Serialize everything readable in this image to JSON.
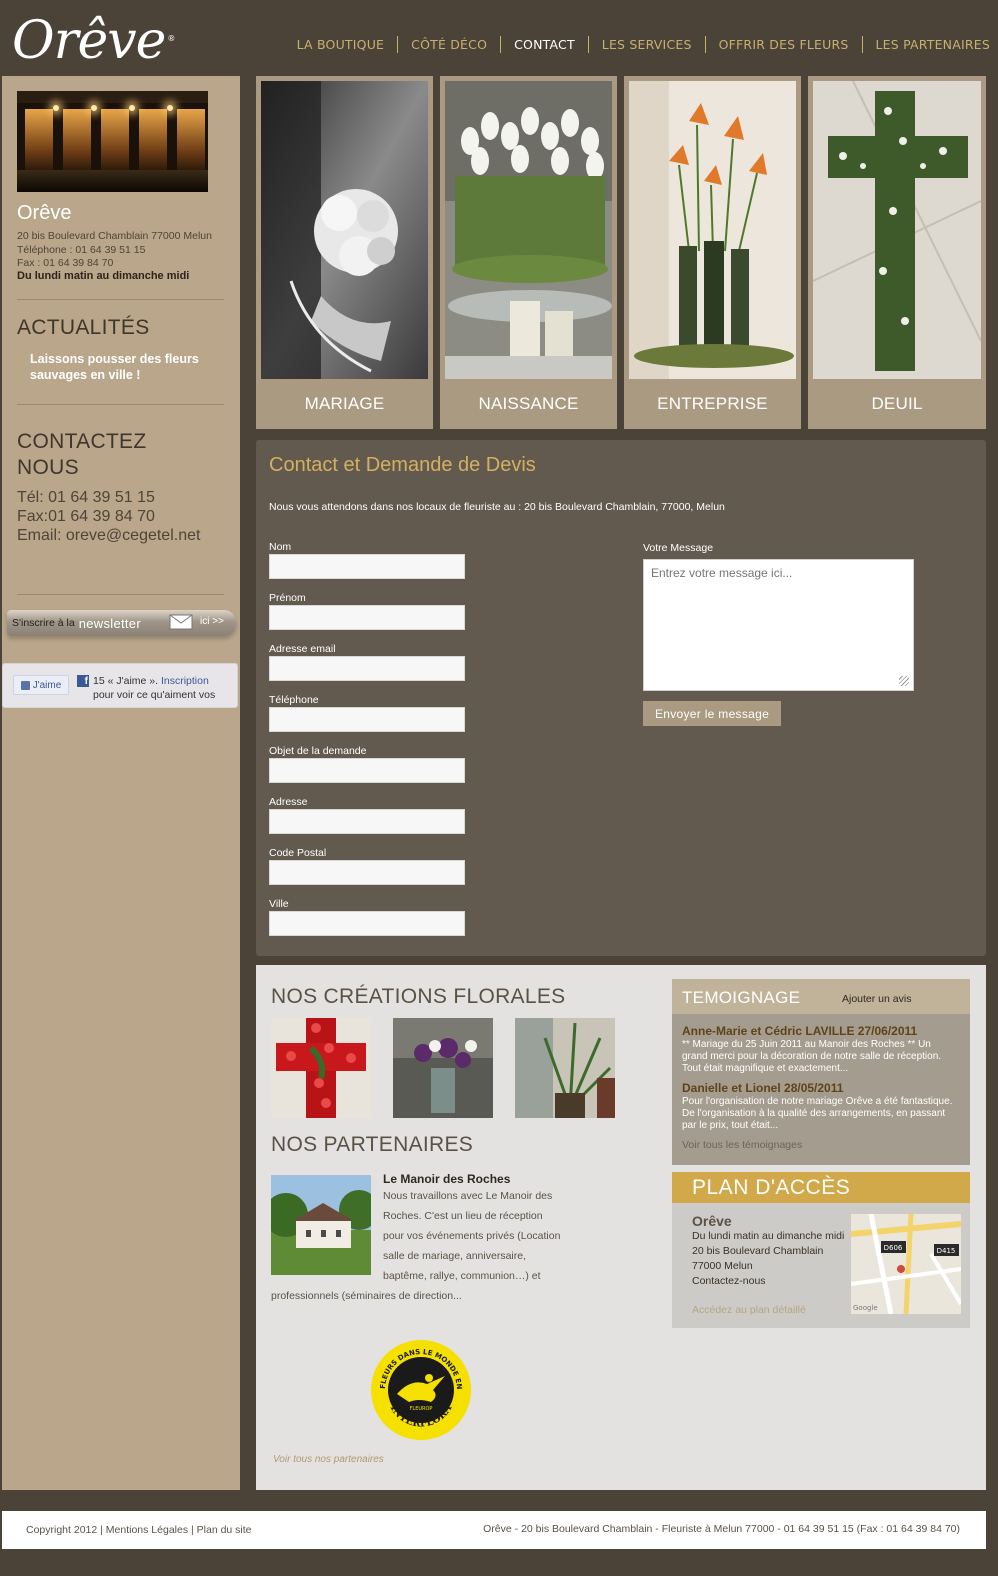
{
  "header": {
    "logo_text": "Orêve",
    "logo_mark": "®",
    "nav": [
      {
        "label": "LA BOUTIQUE"
      },
      {
        "label": "CÔTÉ DÉCO"
      },
      {
        "label": "CONTACT"
      },
      {
        "label": "LES SERVICES"
      },
      {
        "label": "OFFRIR DES FLEURS"
      },
      {
        "label": "LES PARTENAIRES"
      }
    ],
    "active_nav": "CONTACT"
  },
  "sidebar": {
    "shop_name": "Orêve",
    "address": "20 bis Boulevard Chamblain 77000 Melun",
    "phone": "Téléphone : 01 64 39 51 15",
    "fax": "Fax : 01 64 39 84 70",
    "hours": "Du lundi matin au dimanche midi",
    "news_heading": "ACTUALITÉS",
    "news_item": "Laissons pousser des fleurs sauvages en ville !",
    "contact_heading_1": "CONTACTEZ",
    "contact_heading_2": "NOUS",
    "contact_tel": "Tél: 01 64 39 51 15",
    "contact_fax": "Fax:01 64 39 84 70",
    "contact_email": "Email: oreve@cegetel.net",
    "newsletter_pre": "S'inscrire à la",
    "newsletter_big": "newsletter",
    "newsletter_ici": "ici >>",
    "fb_like": "J'aime",
    "fb_count": "15 « J'aime ».",
    "fb_signup": "Inscription",
    "fb_rest": "pour voir ce qu'aiment vos"
  },
  "tiles": [
    {
      "label": "MARIAGE"
    },
    {
      "label": "NAISSANCE"
    },
    {
      "label": "ENTREPRISE"
    },
    {
      "label": "DEUIL"
    }
  ],
  "contact_form": {
    "title": "Contact et Demande de Devis",
    "intro": "Nous vous attendons dans nos locaux de fleuriste au : 20 bis Boulevard Chamblain, 77000, Melun",
    "fields": {
      "nom": "Nom",
      "prenom": "Prénom",
      "email": "Adresse email",
      "telephone": "Téléphone",
      "objet": "Objet de la demande",
      "adresse": "Adresse",
      "cp": "Code Postal",
      "ville": "Ville"
    },
    "message_label": "Votre Message",
    "message_placeholder": "Entrez votre message ici...",
    "submit": "Envoyer le message"
  },
  "creations": {
    "title": "NOS CRÉATIONS FLORALES"
  },
  "partners": {
    "title": "NOS PARTENAIRES",
    "name": "Le Manoir des Roches",
    "description": "Nous travaillons avec Le Manoir des Roches. C'est un lieu de réception pour vos événements privés (Location salle de mariage, anniversaire, baptême, rallye, communion…) et professionnels (séminaires de direction...",
    "interflora_top": "DES FLEURS DANS LE MONDE ENTIER",
    "interflora_mid": "FLEUROP",
    "interflora_bottom": "INTERFLORA",
    "view_all": "Voir tous nos partenaires"
  },
  "testimonials": {
    "title": "TEMOIGNAGE",
    "add": "Ajouter un avis",
    "items": [
      {
        "name": "Anne-Marie et Cédric LAVILLE 27/06/2011",
        "text": "** Mariage du 25 Juin 2011 au Manoir des Roches ** Un grand merci pour la décoration de notre salle de réception. Tout était magnifique et exactement..."
      },
      {
        "name": "Danielle et Lionel 28/05/2011",
        "text": "Pour l'organisation de notre mariage Orêve a été fantastique. De l'organisation à la qualité des arrangements, en passant par le prix, tout était..."
      }
    ],
    "view_all": "Voir tous les témoignages"
  },
  "plan": {
    "title": "PLAN D'ACCÈS",
    "name": "Orêve",
    "hours": "Du lundi matin au dimanche midi",
    "street": "20 bis Boulevard Chamblain",
    "city": "77000 Melun",
    "contact": "Contactez-nous",
    "link": "Accédez au plan détaillé",
    "map_labels": {
      "road1": "D606",
      "road2": "D415",
      "google": "Google"
    }
  },
  "footer": {
    "copyright": "Copyright   2012",
    "mentions": "Mentions Légales",
    "plan_site": "Plan du site",
    "right": "Orêve - 20 bis Boulevard Chamblain - Fleuriste à Melun 77000 - 01 64 39 51 15 (Fax : 01 64 39 84 70)"
  },
  "colors": {
    "background": "#4b4238",
    "sidebar": "#b9a68b",
    "accent_gold": "#d4b060",
    "nav": "#c8b070",
    "form_panel": "#625a4f",
    "tile_frame": "#a99a81"
  }
}
